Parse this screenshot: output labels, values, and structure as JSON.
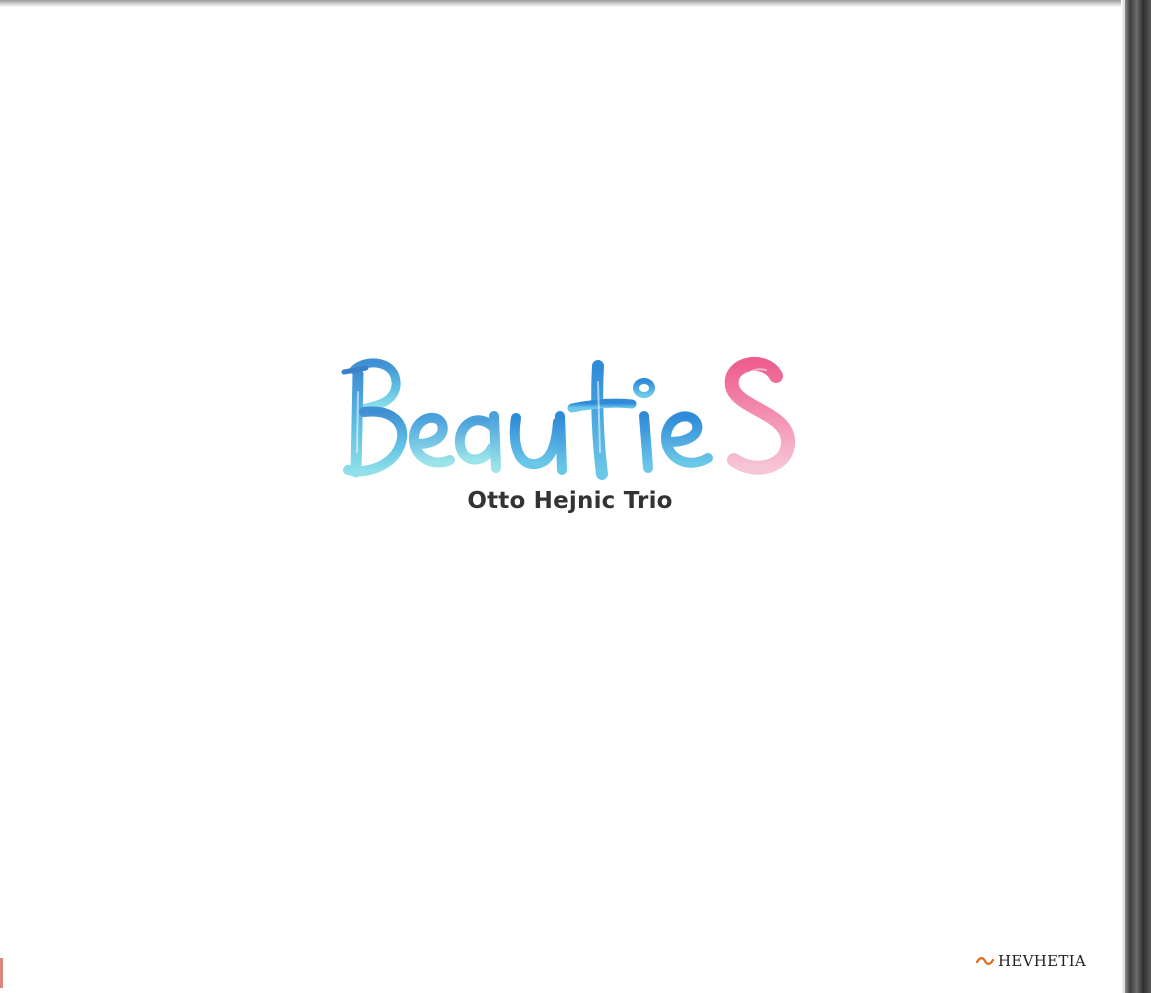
{
  "cover": {
    "title": "BeautieS",
    "artist": "Otto Hejnic Trio",
    "label": "HEVHETIA"
  },
  "icons": {
    "label_logo": "wave-icon"
  },
  "colors": {
    "background": "#ffffff",
    "title_blue": "#4aa8dc",
    "title_cyan": "#7fd6e6",
    "title_pink": "#f07aa0",
    "artist_text": "#333333",
    "label_icon": "#e06a1c"
  }
}
